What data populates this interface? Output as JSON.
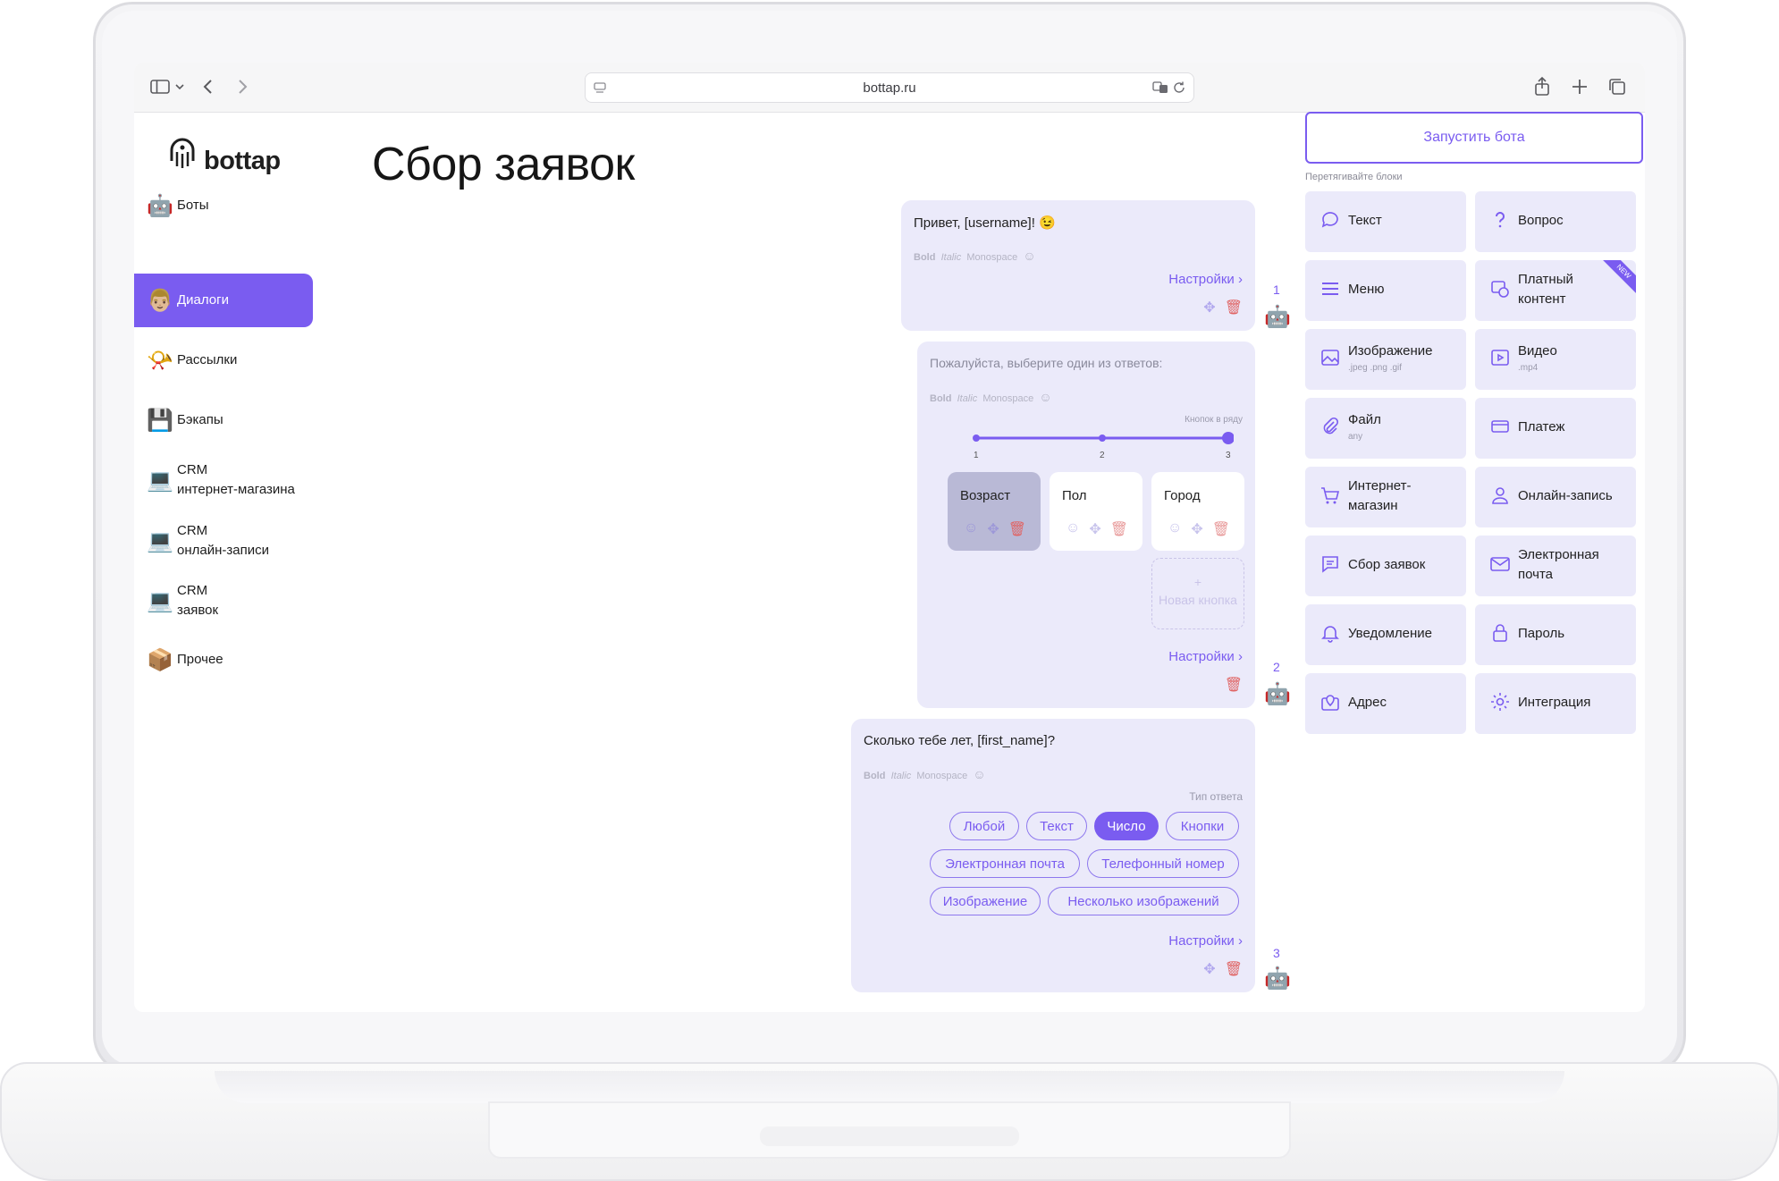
{
  "browser": {
    "url": "bottap.ru"
  },
  "app": {
    "logo_text": "bottap",
    "page_title": "Сбор заявок"
  },
  "sidebar": {
    "items": [
      {
        "label": "Боты",
        "emoji": "🤖"
      },
      {
        "label": "Диалоги",
        "emoji": "👨🏼"
      },
      {
        "label": "Рассылки",
        "emoji": "📯"
      },
      {
        "label": "Бэкапы",
        "emoji": "💾"
      },
      {
        "label": "CRM\nинтернет-магазина",
        "emoji": "💻"
      },
      {
        "label": "CRM\nонлайн-записи",
        "emoji": "💻"
      },
      {
        "label": "CRM\nзаявок",
        "emoji": "💻"
      },
      {
        "label": "Прочее",
        "emoji": "📦"
      }
    ],
    "active_index": 1
  },
  "blocks": {
    "format_bold": "Bold",
    "format_italic": "Italic",
    "format_mono": "Monospace",
    "settings_label": "Настройки",
    "block1": {
      "text": "Привет, [username]! 😉",
      "step": "1"
    },
    "block2": {
      "text": "Пожалуйста, выберите один из ответов:",
      "row_label": "Кнопок в ряду",
      "slider_ticks": [
        "1",
        "2",
        "3"
      ],
      "buttons_per_row": 3,
      "buttons": [
        "Возраст",
        "Пол",
        "Город"
      ],
      "new_button_plus": "+",
      "new_button_label": "Новая кнопка",
      "step": "2"
    },
    "block3": {
      "text": "Сколько тебе лет, [first_name]?",
      "answer_type_label": "Тип ответа",
      "answer_types": [
        "Любой",
        "Текст",
        "Число",
        "Кнопки",
        "Электронная почта",
        "Телефонный номер",
        "Изображение",
        "Несколько изображений"
      ],
      "selected_type": "Число",
      "step": "3"
    }
  },
  "palette": {
    "launch_button": "Запустить бота",
    "drag_hint": "Перетягивайте блоки",
    "new_badge": "NEW",
    "tiles": [
      {
        "label": "Текст",
        "sub": "",
        "icon": "chat-bubble-icon"
      },
      {
        "label": "Вопрос",
        "sub": "",
        "icon": "question-icon"
      },
      {
        "label": "Меню",
        "sub": "",
        "icon": "menu-icon"
      },
      {
        "label": "Платный\nконтент",
        "sub": "",
        "icon": "paid-content-icon"
      },
      {
        "label": "Изображение",
        "sub": ".jpeg .png .gif",
        "icon": "image-icon"
      },
      {
        "label": "Видео",
        "sub": ".mp4",
        "icon": "video-icon"
      },
      {
        "label": "Файл",
        "sub": "any",
        "icon": "paperclip-icon"
      },
      {
        "label": "Платеж",
        "sub": "",
        "icon": "card-icon"
      },
      {
        "label": "Интернет-\nмагазин",
        "sub": "",
        "icon": "cart-icon"
      },
      {
        "label": "Онлайн-запись",
        "sub": "",
        "icon": "person-icon"
      },
      {
        "label": "Сбор заявок",
        "sub": "",
        "icon": "form-icon"
      },
      {
        "label": "Электронная\nпочта",
        "sub": "",
        "icon": "mail-icon"
      },
      {
        "label": "Уведомление",
        "sub": "",
        "icon": "bell-icon"
      },
      {
        "label": "Пароль",
        "sub": "",
        "icon": "lock-icon"
      },
      {
        "label": "Адрес",
        "sub": "",
        "icon": "map-icon"
      },
      {
        "label": "Интеграция",
        "sub": "",
        "icon": "gear-icon"
      }
    ]
  },
  "colors": {
    "accent": "#7a5cf0",
    "block_bg": "#ebeafa",
    "delete": "#e06464"
  }
}
